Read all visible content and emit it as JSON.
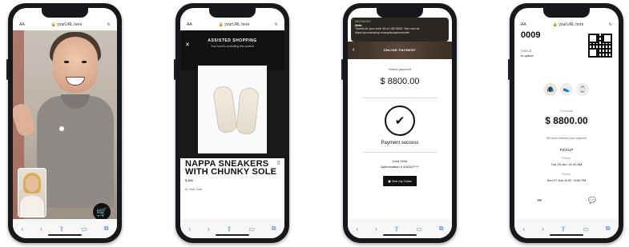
{
  "browser": {
    "url": "yourURL.here",
    "aa_label": "AA"
  },
  "toolbar_icons": [
    "back-icon",
    "forward-icon",
    "share-icon",
    "bookmarks-icon",
    "tabs-icon"
  ],
  "phone2": {
    "header_title": "ASSISTED SHOPPING",
    "header_subtitle": "Your host is controlling this content",
    "product_title": "NAPPA SNEAKERS WITH CHUNKY SOLE",
    "price": "$ 880",
    "size_hint": "In Your Cart"
  },
  "phone3": {
    "notif_app": "MESSAGES",
    "notif_title": "Hello",
    "notif_text": "Thanks for your order #9 of USD 8800. See more at https://yourwebshop.example/paymentorder",
    "header_title": "ONLINE PAYMENT",
    "subtitle": "Online payment",
    "amount": "$ 8800.00",
    "success_text": "Payment success",
    "card_line": "Card VISA",
    "auth_line": "Authorization # 434242****",
    "button_label": "See my Order"
  },
  "phone4": {
    "order_number": "0009",
    "status_label": "STATUS",
    "status_value": "In queue",
    "items_label": "3 products",
    "amount": "$ 8800.00",
    "note": "We have received your payment",
    "tag": "PICKUP",
    "pickup_label": "Pickup:",
    "date1": "Tue 25 Jun, 11:52 AM",
    "date_label": "Pickup:",
    "date2": "Sun 27 Jun, 6:00 - 6:00 PM"
  }
}
